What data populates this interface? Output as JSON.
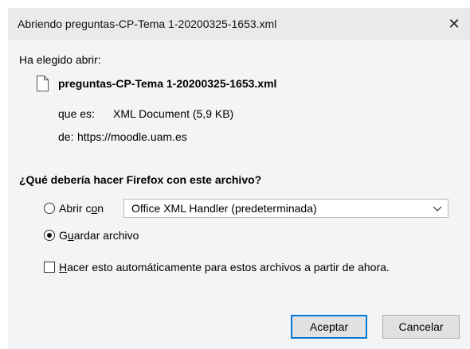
{
  "window": {
    "title": "Abriendo preguntas-CP-Tema 1-20200325-1653.xml",
    "close_symbol": "✕"
  },
  "intro": {
    "chosen_label": "Ha elegido abrir:"
  },
  "file": {
    "icon": "document-icon",
    "name": "preguntas-CP-Tema 1-20200325-1653.xml",
    "type_label": "que es:",
    "type_value": "XML Document (5,9 KB)",
    "source_label": "de:",
    "source_value": "https://moodle.uam.es"
  },
  "question": "¿Qué debería hacer Firefox con este archivo?",
  "options": {
    "open_with": {
      "label_before": "Abrir c",
      "label_underlined": "o",
      "label_after": "n",
      "selected": false,
      "app_value": "Office XML Handler (predeterminada)"
    },
    "save_file": {
      "label_before": "G",
      "label_underlined": "u",
      "label_after": "ardar archivo",
      "selected": true
    },
    "auto": {
      "label_underlined": "H",
      "label_after": "acer esto automáticamente para estos archivos a partir de ahora.",
      "checked": false
    }
  },
  "buttons": {
    "accept": "Aceptar",
    "cancel": "Cancelar"
  }
}
